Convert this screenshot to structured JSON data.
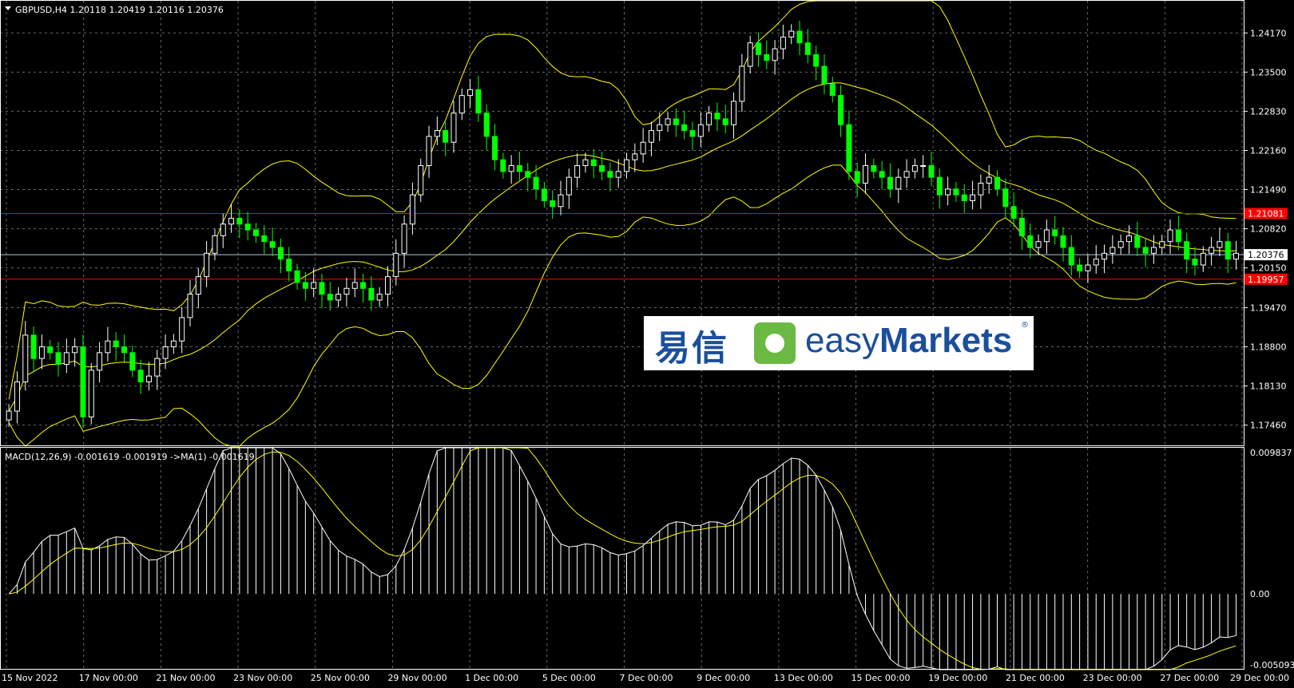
{
  "header": {
    "symbol_line": "GBPUSD,H4  1.20118 1.20419 1.20116 1.20376",
    "macd_line": "MACD(12,26,9) -0.001619 -0.001919  ->MA(1) -0.001619"
  },
  "logo": {
    "cn": "易信",
    "en_light": "easy",
    "en_bold": "Markets",
    "reg": "®"
  },
  "colors": {
    "background": "#000000",
    "bull": "#ffffff",
    "bear": "#00ff00",
    "bollinger": "#ffff00",
    "hline": "#ff0000",
    "bid": "#b0c4de",
    "macd_hist": "#ffffff",
    "macd_signal": "#ffff00"
  },
  "chart_data": {
    "type": "candlestick",
    "timeframe": "H4",
    "price_axis": {
      "min": 1.171,
      "max": 1.2472,
      "ticks": [
        "1.24170",
        "1.23500",
        "1.22830",
        "1.22160",
        "1.21490",
        "1.20820",
        "1.20150",
        "1.19470",
        "1.18800",
        "1.18130",
        "1.17460"
      ]
    },
    "x_labels": [
      "15 Nov 2022",
      "17 Nov 00:00",
      "21 Nov 00:00",
      "23 Nov 00:00",
      "25 Nov 00:00",
      "29 Nov 00:00",
      "1 Dec 00:00",
      "5 Dec 00:00",
      "7 Dec 00:00",
      "9 Dec 00:00",
      "13 Dec 00:00",
      "15 Dec 00:00",
      "19 Dec 00:00",
      "21 Dec 00:00",
      "23 Dec 00:00",
      "27 Dec 00:00",
      "29 Dec 00:00"
    ],
    "horizontal_lines": [
      {
        "price": 1.21081,
        "label": "1.21081",
        "color": "#ff0000"
      },
      {
        "price": 1.19957,
        "label": "1.19957",
        "color": "#ff0000"
      },
      {
        "price": 1.20376,
        "label": "1.20376",
        "color": "#b0c4de"
      }
    ],
    "close_series": [
      1.177,
      1.182,
      1.19,
      1.186,
      1.188,
      1.187,
      1.185,
      1.187,
      1.188,
      1.176,
      1.184,
      1.187,
      1.189,
      1.188,
      1.187,
      1.184,
      1.182,
      1.183,
      1.186,
      1.188,
      1.189,
      1.193,
      1.197,
      1.2,
      1.204,
      1.207,
      1.209,
      1.21,
      1.209,
      1.208,
      1.207,
      1.206,
      1.205,
      1.203,
      1.201,
      1.199,
      1.198,
      1.199,
      1.197,
      1.196,
      1.197,
      1.198,
      1.199,
      1.198,
      1.196,
      1.197,
      1.2,
      1.204,
      1.209,
      1.214,
      1.219,
      1.224,
      1.225,
      1.223,
      1.228,
      1.231,
      1.232,
      1.228,
      1.224,
      1.22,
      1.218,
      1.219,
      1.218,
      1.217,
      1.215,
      1.213,
      1.212,
      1.214,
      1.217,
      1.219,
      1.22,
      1.219,
      1.218,
      1.217,
      1.218,
      1.22,
      1.221,
      1.223,
      1.225,
      1.226,
      1.227,
      1.226,
      1.225,
      1.224,
      1.226,
      1.228,
      1.227,
      1.226,
      1.23,
      1.236,
      1.24,
      1.238,
      1.237,
      1.239,
      1.241,
      1.242,
      1.24,
      1.238,
      1.236,
      1.233,
      1.231,
      1.226,
      1.218,
      1.216,
      1.219,
      1.218,
      1.217,
      1.215,
      1.217,
      1.218,
      1.219,
      1.219,
      1.217,
      1.214,
      1.215,
      1.214,
      1.213,
      1.214,
      1.216,
      1.217,
      1.215,
      1.212,
      1.21,
      1.207,
      1.205,
      1.206,
      1.208,
      1.207,
      1.205,
      1.202,
      1.201,
      1.202,
      1.203,
      1.204,
      1.205,
      1.206,
      1.207,
      1.205,
      1.204,
      1.205,
      1.206,
      1.208,
      1.206,
      1.203,
      1.202,
      1.204,
      1.205,
      1.206,
      1.203,
      1.204
    ],
    "macd": {
      "y_ticks": [
        "0.009837",
        "0.00",
        "-0.005093"
      ],
      "y_max": 0.009837,
      "y_min": -0.005093,
      "current": {
        "main": -0.001619,
        "signal": -0.001919
      }
    }
  }
}
